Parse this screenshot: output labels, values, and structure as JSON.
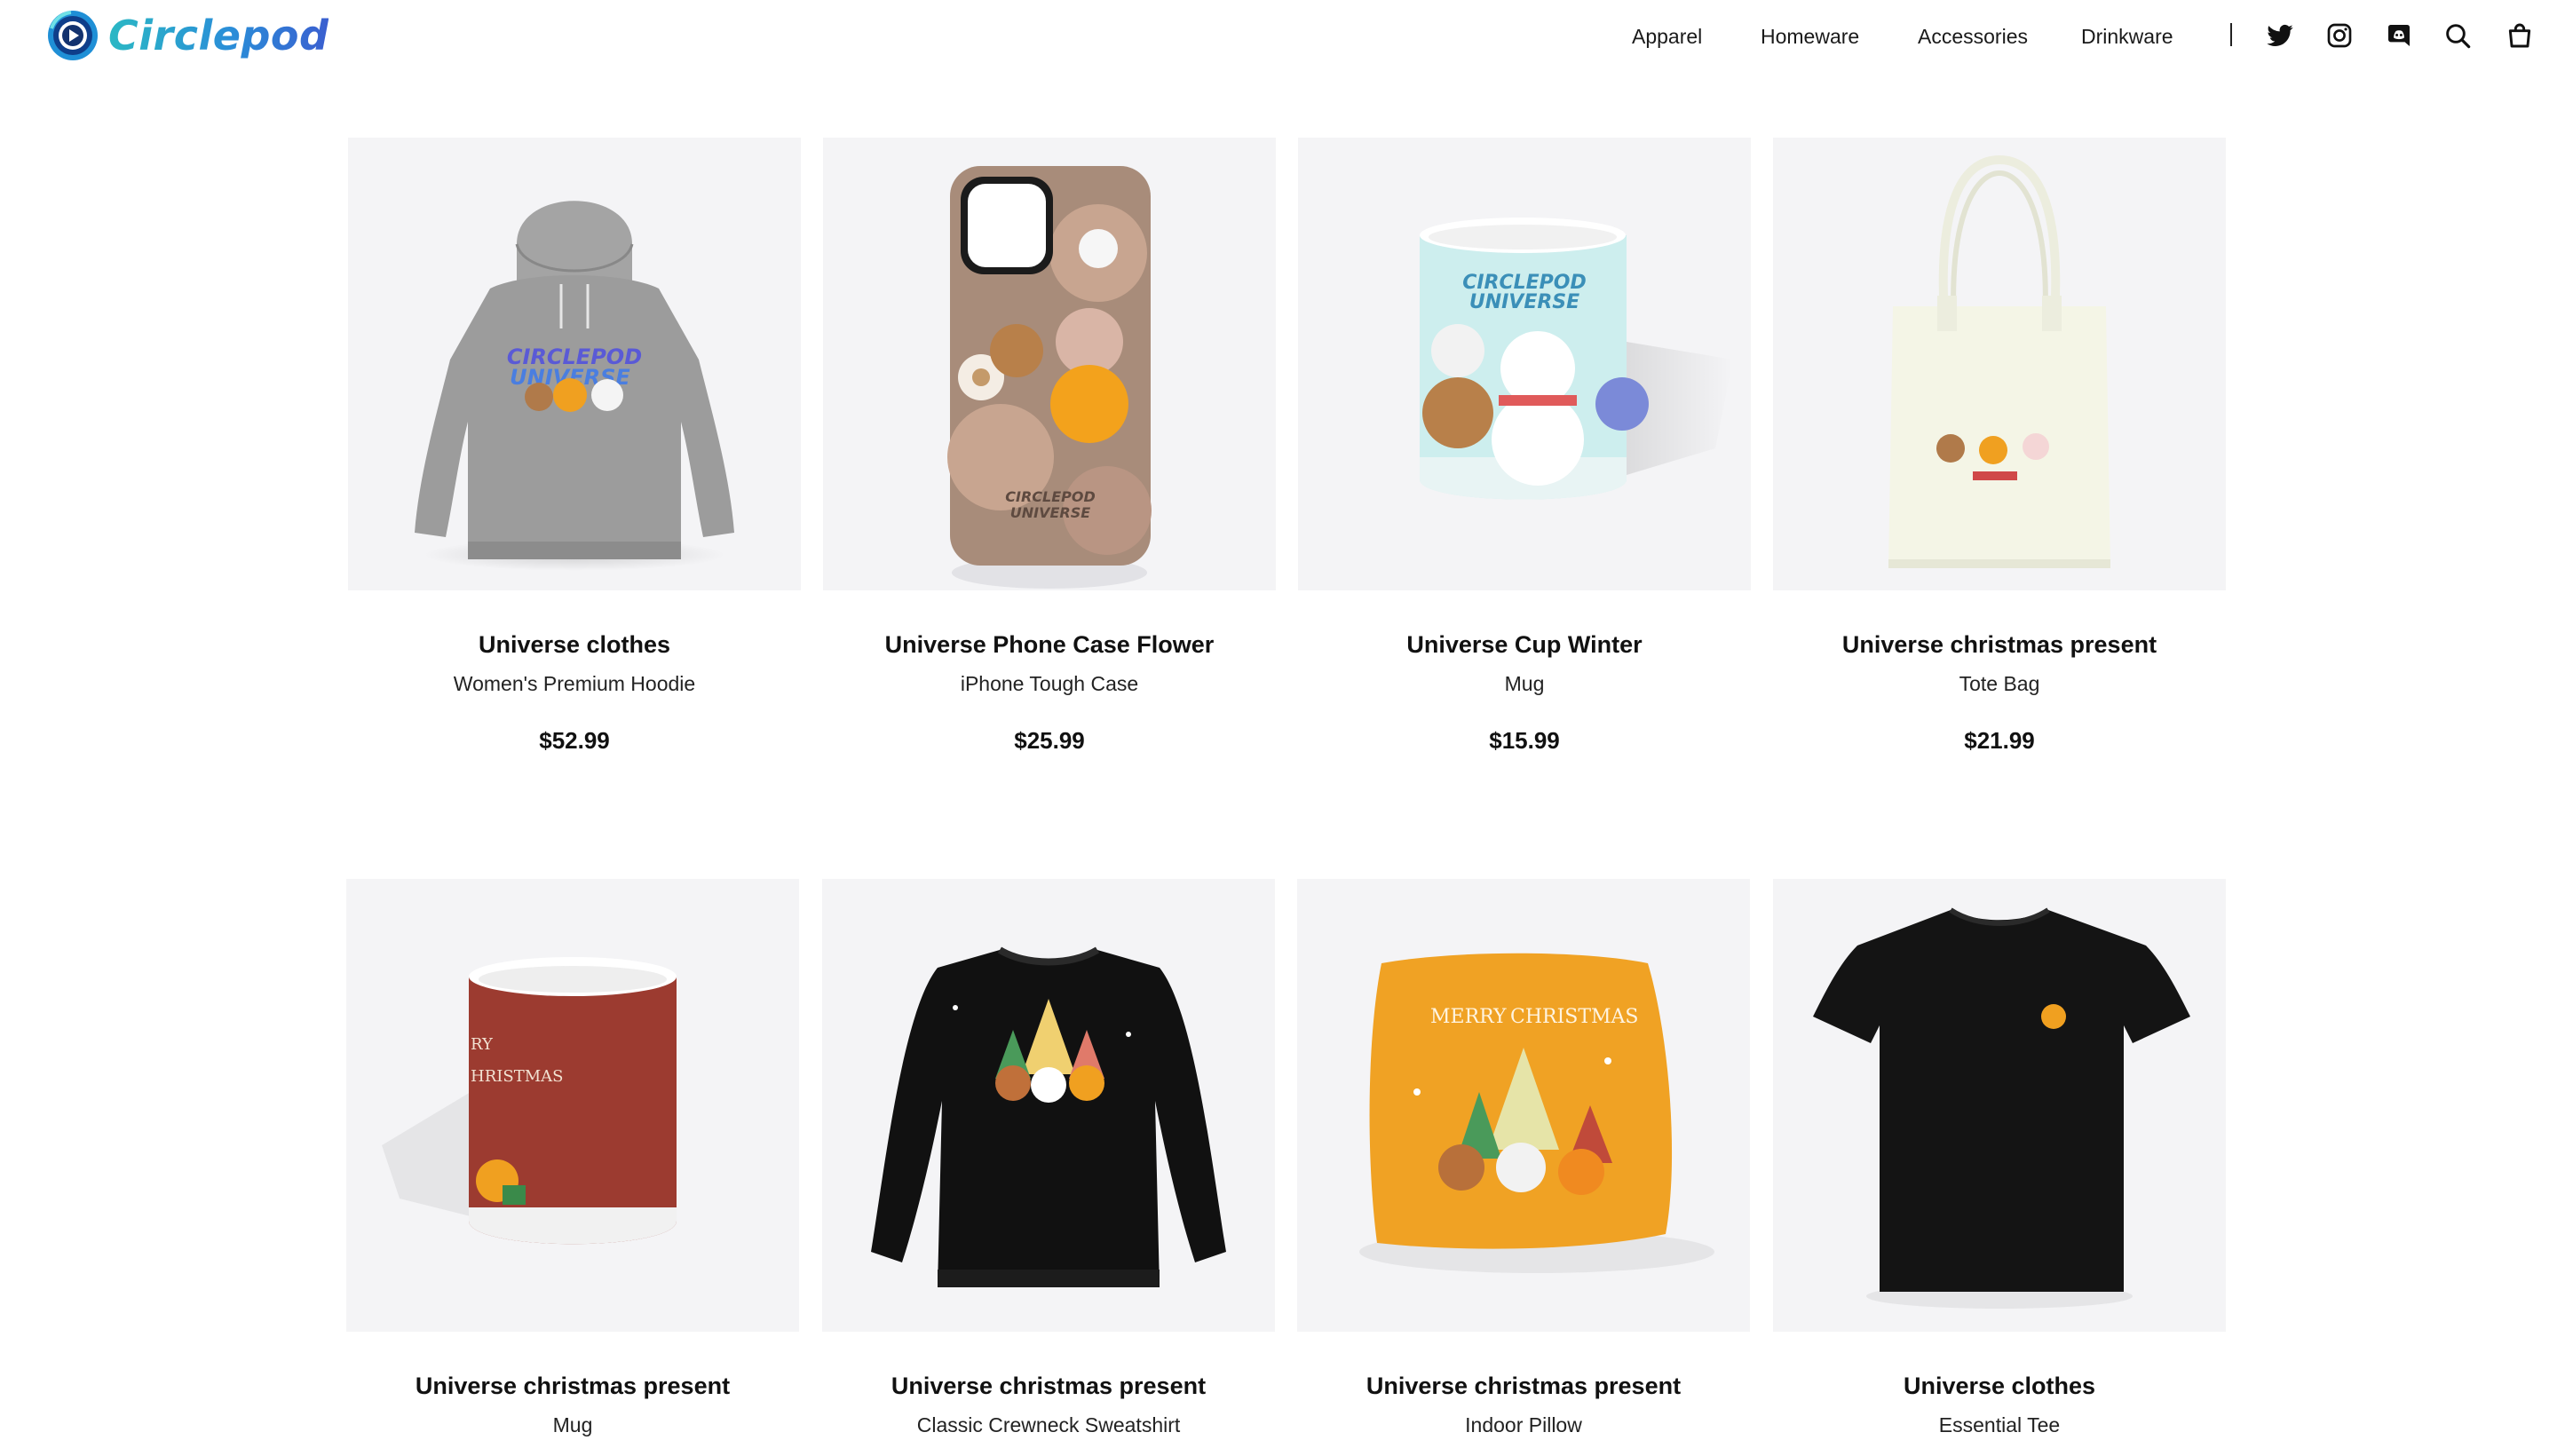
{
  "brand": {
    "name": "Circlepod"
  },
  "nav": {
    "links": [
      "Apparel",
      "Homeware",
      "Accessories",
      "Drinkware"
    ],
    "separator": "|"
  },
  "header_icons": [
    "twitter-icon",
    "instagram-icon",
    "discord-icon",
    "search-icon",
    "shopping-bag-icon"
  ],
  "colors": {
    "brand_gradient_start": "#2bb8c4",
    "brand_gradient_end": "#3a5fd0",
    "card_background": "#f4f4f6",
    "text": "#111111"
  },
  "products": [
    {
      "title": "Universe clothes",
      "type": "Women's Premium Hoodie",
      "price": "$52.99"
    },
    {
      "title": "Universe Phone Case Flower",
      "type": "iPhone Tough Case",
      "price": "$25.99"
    },
    {
      "title": "Universe Cup Winter",
      "type": "Mug",
      "price": "$15.99"
    },
    {
      "title": "Universe christmas present",
      "type": "Tote Bag",
      "price": "$21.99"
    },
    {
      "title": "Universe christmas present",
      "type": "Mug",
      "price": ""
    },
    {
      "title": "Universe christmas present",
      "type": "Classic Crewneck Sweatshirt",
      "price": ""
    },
    {
      "title": "Universe christmas present",
      "type": "Indoor Pillow",
      "price": ""
    },
    {
      "title": "Universe clothes",
      "type": "Essential Tee",
      "price": ""
    }
  ],
  "image_text": {
    "universe_logo_line1": "CIRCLEPOD",
    "universe_logo_line2": "UNIVERSE",
    "merry": "MERRY",
    "christmas": "CHRISTMAS",
    "mug_christmas_partial": "HRISTMAS",
    "mug_merry_partial": "RY"
  }
}
